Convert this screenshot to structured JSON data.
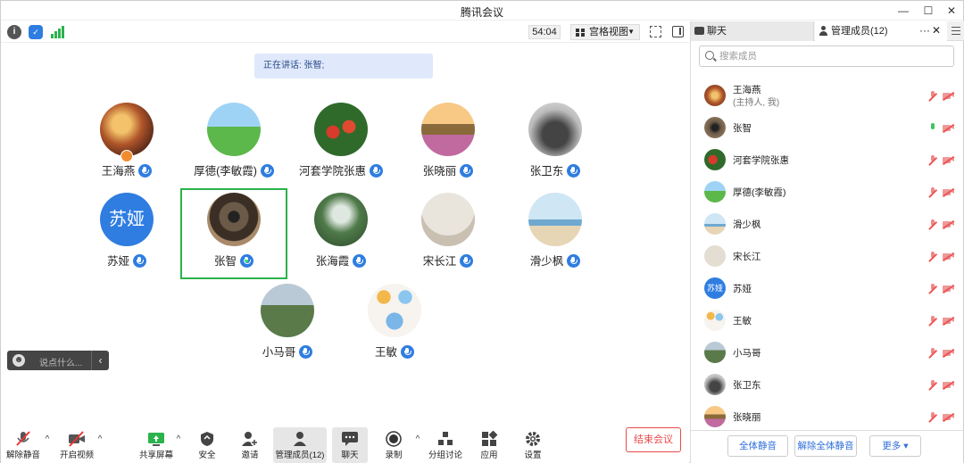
{
  "window": {
    "title": "腾讯会议"
  },
  "topbar": {
    "timer": "54:04",
    "view_label": "宫格视图"
  },
  "speaking": "正在讲话: 张智;",
  "tiles": [
    {
      "name": "王海燕"
    },
    {
      "name": "厚德(李敏霞)"
    },
    {
      "name": "河套学院张惠"
    },
    {
      "name": "张晓丽"
    },
    {
      "name": "张卫东"
    },
    {
      "name": "苏娅",
      "avatar_text": "苏娅"
    },
    {
      "name": "张智"
    },
    {
      "name": "张海霞"
    },
    {
      "name": "宋长江"
    },
    {
      "name": "滑少枫"
    },
    {
      "name": "小马哥"
    },
    {
      "name": "王敏"
    }
  ],
  "chatbox": {
    "placeholder": "说点什么..."
  },
  "toolbar": {
    "unmute": "解除静音",
    "video": "开启视频",
    "share": "共享屏幕",
    "security": "安全",
    "invite": "邀请",
    "members": "管理成员(12)",
    "chat": "聊天",
    "record": "录制",
    "breakout": "分组讨论",
    "apps": "应用",
    "settings": "设置",
    "end": "结束会议"
  },
  "panel": {
    "tab_chat": "聊天",
    "tab_members": "管理成员(12)",
    "more": "···",
    "close": "✕",
    "search_placeholder": "搜索成员",
    "members": [
      {
        "name": "王海燕",
        "sub": "(主持人, 我)"
      },
      {
        "name": "张智",
        "mic_on": true
      },
      {
        "name": "河套学院张惠"
      },
      {
        "name": "厚德(李敏霞)"
      },
      {
        "name": "滑少枫"
      },
      {
        "name": "宋长江"
      },
      {
        "name": "苏娅",
        "avatar_text": "苏娅"
      },
      {
        "name": "王敏"
      },
      {
        "name": "小马哥"
      },
      {
        "name": "张卫东"
      },
      {
        "name": "张晓丽"
      }
    ],
    "mute_all": "全体静音",
    "unmute_all": "解除全体静音",
    "more_btn": "更多 ▾"
  },
  "colors": {
    "accent": "#2f7de1",
    "speaking_border": "#2bb24c",
    "end": "#e94a4a"
  }
}
